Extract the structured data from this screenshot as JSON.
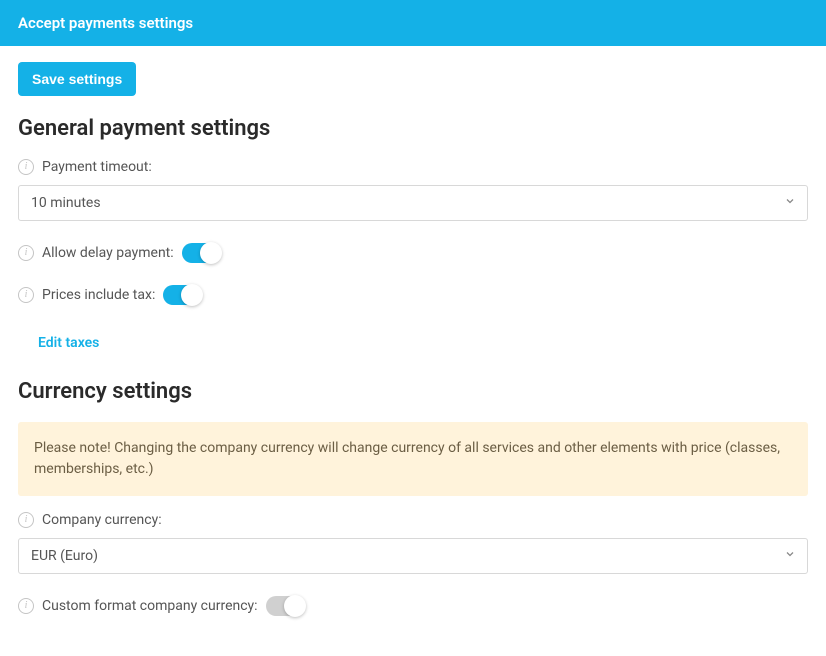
{
  "header": {
    "title": "Accept payments settings"
  },
  "actions": {
    "save_label": "Save settings"
  },
  "sections": {
    "general": {
      "title": "General payment settings",
      "payment_timeout_label": "Payment timeout:",
      "payment_timeout_value": "10 minutes",
      "allow_delay_label": "Allow delay payment:",
      "allow_delay_value": true,
      "prices_include_tax_label": "Prices include tax:",
      "prices_include_tax_value": true,
      "edit_taxes_label": "Edit taxes"
    },
    "currency": {
      "title": "Currency settings",
      "notice": "Please note! Changing the company currency will change currency of all services and other elements with price (classes, memberships, etc.)",
      "company_currency_label": "Company currency:",
      "company_currency_value": "EUR (Euro)",
      "custom_format_label": "Custom format company currency:",
      "custom_format_value": false
    }
  },
  "icons": {
    "info_glyph": "i"
  }
}
